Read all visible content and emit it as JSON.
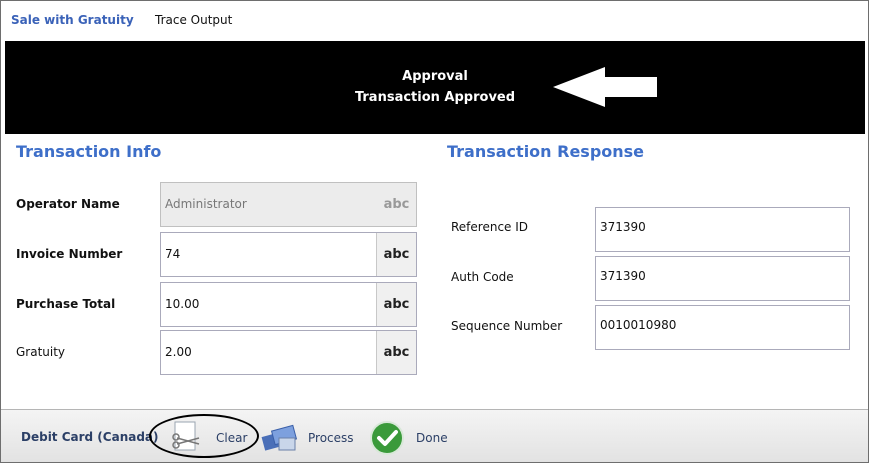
{
  "tabs": [
    {
      "label": "Sale with Gratuity",
      "active": true
    },
    {
      "label": "Trace Output",
      "active": false
    }
  ],
  "banner": {
    "line1": "Approval",
    "line2": "Transaction Approved",
    "background": "#000000",
    "arrow_icon": "left-arrow-icon"
  },
  "transaction_info": {
    "title": "Transaction Info",
    "fields": [
      {
        "label": "Operator Name",
        "value": "Administrator",
        "suffix": "abc",
        "disabled": true
      },
      {
        "label": "Invoice Number",
        "value": "74",
        "suffix": "abc",
        "disabled": false
      },
      {
        "label": "Purchase Total",
        "value": "10.00",
        "suffix": "abc",
        "disabled": false
      },
      {
        "label": "Gratuity",
        "value": "2.00",
        "suffix": "abc",
        "disabled": false
      }
    ]
  },
  "transaction_response": {
    "title": "Transaction Response",
    "fields": [
      {
        "label": "Reference ID",
        "value": "371390"
      },
      {
        "label": "Auth Code",
        "value": "371390"
      },
      {
        "label": "Sequence Number",
        "value": "0010010980"
      }
    ]
  },
  "bottom_bar": {
    "title": "Debit Card (Canada)",
    "buttons": [
      {
        "label": "Clear",
        "icon": "clear-scissors-icon"
      },
      {
        "label": "Process",
        "icon": "process-card-icon"
      },
      {
        "label": "Done",
        "icon": "checkmark-icon"
      }
    ]
  },
  "colors": {
    "accent": "#3e6fc9",
    "tab_active": "#3a62b8",
    "done_green": "#3a9a3a"
  }
}
